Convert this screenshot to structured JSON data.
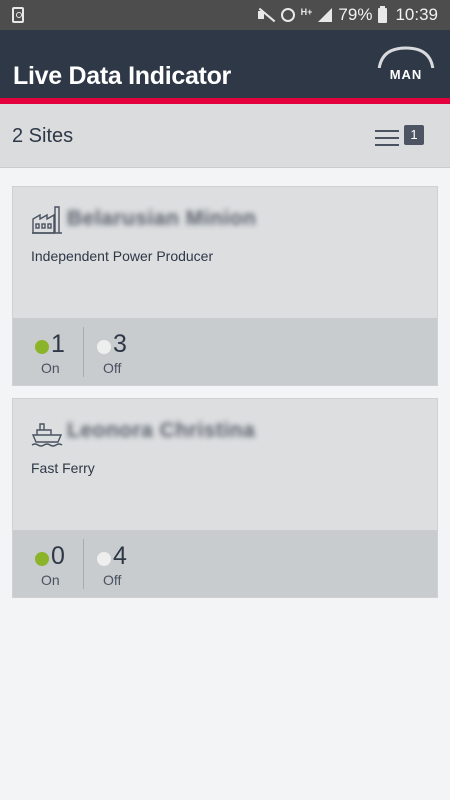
{
  "status_bar": {
    "battery_percent": "79%",
    "time": "10:39",
    "network": "H+"
  },
  "app": {
    "title": "Live Data Indicator",
    "logo_text": "MAN"
  },
  "sites_bar": {
    "count_label": "2 Sites",
    "filter_badge": "1"
  },
  "sites": [
    {
      "name": "Belarusian Minion",
      "type": "Independent Power Producer",
      "icon": "factory-icon",
      "on_count": "1",
      "on_label": "On",
      "off_count": "3",
      "off_label": "Off"
    },
    {
      "name": "Leonora Christina",
      "type": "Fast Ferry",
      "icon": "ship-icon",
      "on_count": "0",
      "on_label": "On",
      "off_count": "4",
      "off_label": "Off"
    }
  ],
  "colors": {
    "header": "#2e3846",
    "accent_red": "#e4003d",
    "on_dot": "#8cb42a",
    "off_dot": "#eeeeee"
  }
}
